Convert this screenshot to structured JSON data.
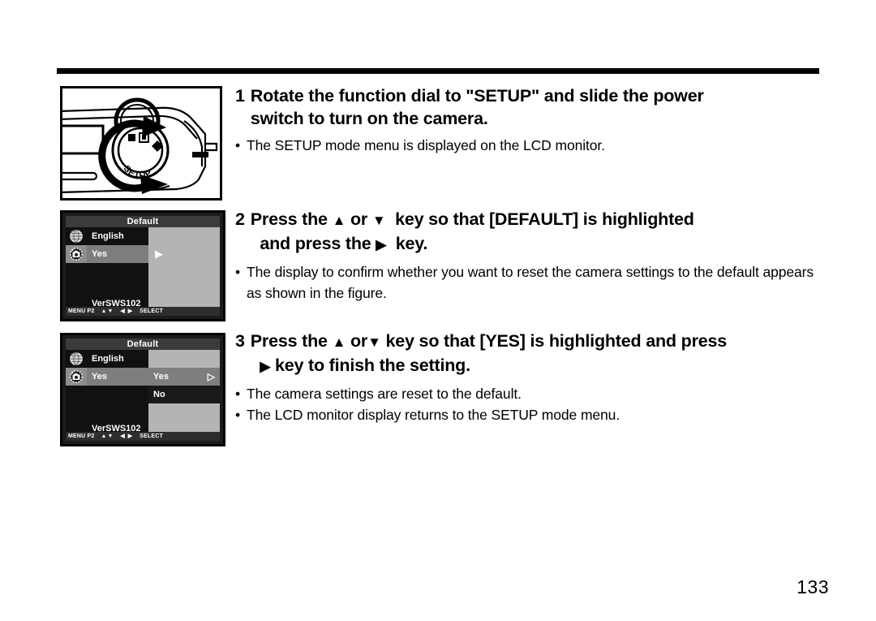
{
  "page": {
    "number": "133"
  },
  "figure": {
    "camera": {
      "dial_label": "SETUP",
      "alt": "camera-top-function-dial-illustration"
    },
    "lcd_screens": [
      {
        "title": "Default",
        "left_icons": [
          "language-globe-icon",
          "camera-reset-icon"
        ],
        "menu_rows": [
          {
            "label": "English",
            "highlighted": false
          },
          {
            "label": "Yes",
            "highlighted": true
          }
        ],
        "right_panel": {
          "arrow": "▶",
          "rows": []
        },
        "version": "VerSWS102",
        "status": {
          "menu": "MENU P2",
          "vertical_keys": "▲▼",
          "horizontal_keys": "◀ ▶",
          "select": "SELECT"
        }
      },
      {
        "title": "Default",
        "left_icons": [
          "language-globe-icon",
          "camera-reset-icon"
        ],
        "menu_rows": [
          {
            "label": "English",
            "highlighted": false
          },
          {
            "label": "Yes",
            "highlighted": true
          }
        ],
        "right_panel": {
          "arrow": "▷",
          "rows": [
            {
              "label": "Yes",
              "highlighted": true,
              "arrow": "▷"
            },
            {
              "label": "No",
              "highlighted": false,
              "arrow": ""
            }
          ]
        },
        "version": "VerSWS102",
        "status": {
          "menu": "MENU P2",
          "vertical_keys": "▲▼",
          "horizontal_keys": "◀ ▶",
          "select": "SELECT"
        }
      }
    ]
  },
  "steps": [
    {
      "number": "1",
      "heading_line1": "Rotate the function dial to \"SETUP\" and slide the power",
      "heading_line2": "switch to turn on the camera.",
      "bullets": [
        "The SETUP mode menu is displayed on the LCD monitor."
      ]
    },
    {
      "number": "2",
      "heading_a": "Press the",
      "heading_up": "▲",
      "heading_or": "or",
      "heading_down": "▼",
      "heading_b": "key so that [DEFAULT] is highlighted",
      "heading_line2_a": "and press the",
      "heading_right": "▶",
      "heading_line2_b": "key.",
      "bullets": [
        "The display to confirm whether you want to reset the camera settings to the default appears as shown in the figure."
      ]
    },
    {
      "number": "3",
      "heading_a": "Press the",
      "heading_up": "▲",
      "heading_or": "or",
      "heading_down": "▼",
      "heading_b": "key so that [YES] is highlighted and press",
      "heading_right": "▶",
      "heading_line2_b": "key to finish the setting.",
      "bullets": [
        "The camera settings are reset to the default.",
        "The LCD monitor display returns to the SETUP mode menu."
      ]
    }
  ],
  "bullet_marker": "•"
}
